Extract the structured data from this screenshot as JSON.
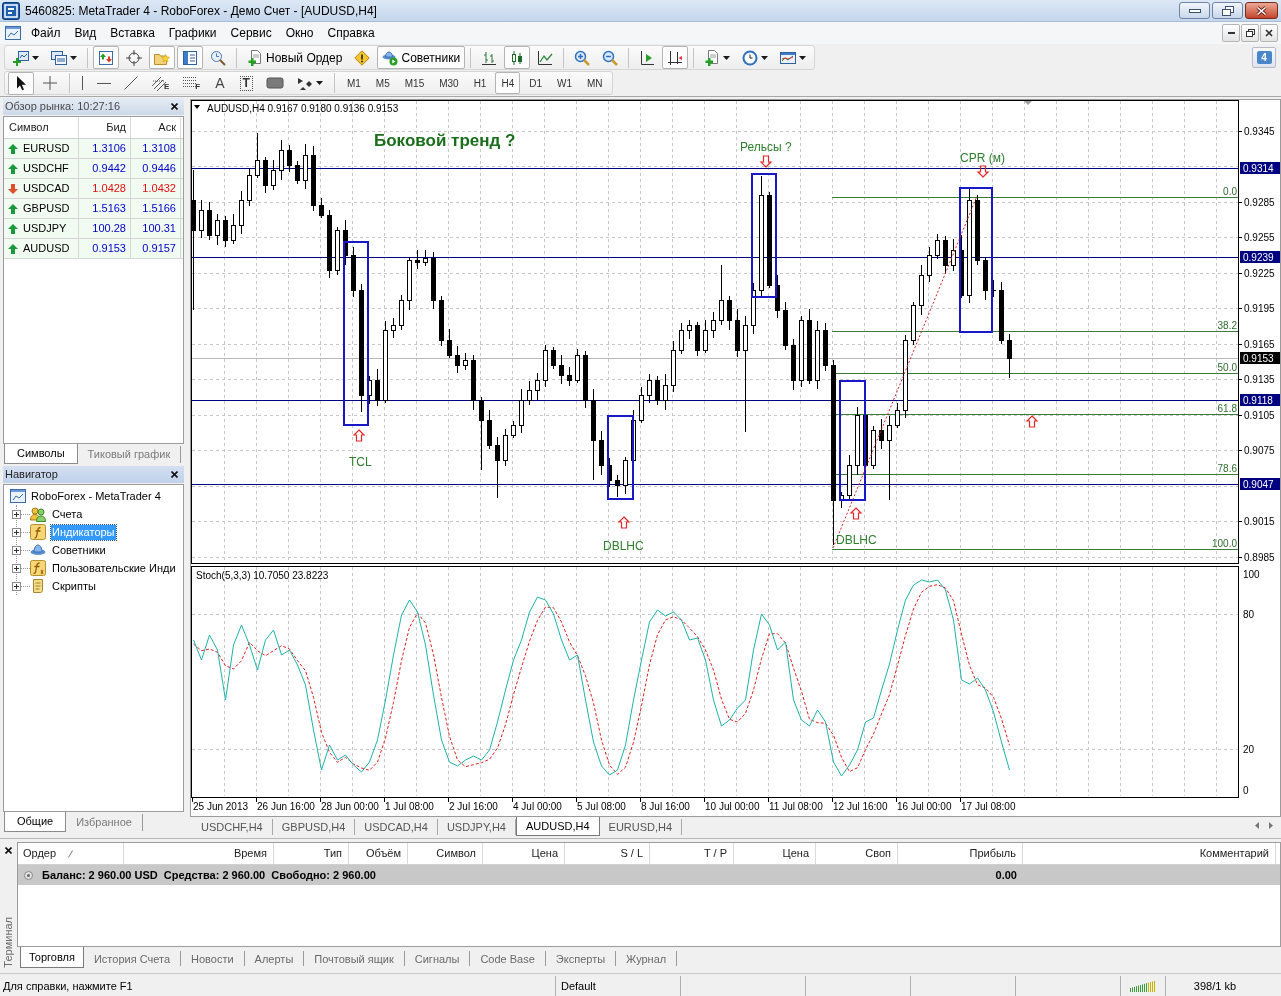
{
  "window": {
    "title": "5460825: MetaTrader 4 - RoboForex - Демо Счет - [AUDUSD,H4]"
  },
  "menu": [
    "Файл",
    "Вид",
    "Вставка",
    "Графики",
    "Сервис",
    "Окно",
    "Справка"
  ],
  "toolbar": [
    [
      {
        "kind": "new-chart",
        "dropdown": true,
        "pressed": false
      },
      {
        "kind": "profiles",
        "dropdown": true,
        "pressed": false
      }
    ],
    [
      {
        "kind": "market-watch",
        "pressed": true
      },
      {
        "kind": "data-window",
        "pressed": false
      },
      {
        "kind": "navigator",
        "pressed": true
      },
      {
        "kind": "terminal",
        "pressed": true
      },
      {
        "kind": "tester",
        "pressed": false
      }
    ],
    [
      {
        "kind": "new-order",
        "label": "Новый Ордер",
        "pressed": false
      },
      {
        "kind": "autotrading-alert",
        "pressed": false
      },
      {
        "kind": "experts",
        "label": "Советники",
        "pressed": true
      }
    ],
    [
      {
        "kind": "bar-chart",
        "pressed": false
      },
      {
        "kind": "candlesticks",
        "pressed": true
      },
      {
        "kind": "line-chart",
        "pressed": false
      }
    ],
    [
      {
        "kind": "zoom-in",
        "pressed": false
      },
      {
        "kind": "zoom-out",
        "pressed": false
      }
    ],
    [
      {
        "kind": "auto-scroll",
        "pressed": false
      },
      {
        "kind": "chart-shift",
        "pressed": true
      }
    ],
    [
      {
        "kind": "indicators",
        "dropdown": true,
        "pressed": false
      },
      {
        "kind": "periods",
        "dropdown": true,
        "pressed": false
      },
      {
        "kind": "templates",
        "dropdown": true,
        "pressed": false
      }
    ]
  ],
  "drawing_tools": [
    [
      {
        "kind": "cursor",
        "pressed": true
      },
      {
        "kind": "crosshair",
        "pressed": false
      }
    ],
    [
      {
        "kind": "vertical-line",
        "pressed": false
      },
      {
        "kind": "horizontal-line",
        "pressed": false
      },
      {
        "kind": "trendline",
        "pressed": false
      },
      {
        "kind": "fibo-channel",
        "glyph": "E",
        "pressed": false
      },
      {
        "kind": "fibo-levels",
        "glyph": "F",
        "pressed": false
      },
      {
        "kind": "text",
        "glyph": "A",
        "pressed": false
      },
      {
        "kind": "text-label",
        "glyph": "T",
        "pressed": false
      },
      {
        "kind": "rectangle",
        "pressed": false
      },
      {
        "kind": "arrows",
        "dropdown": true,
        "pressed": false
      }
    ]
  ],
  "periods": [
    {
      "label": "M1",
      "selected": false
    },
    {
      "label": "M5",
      "selected": false
    },
    {
      "label": "M15",
      "selected": false
    },
    {
      "label": "M30",
      "selected": false
    },
    {
      "label": "H1",
      "selected": false
    },
    {
      "label": "H4",
      "selected": true
    },
    {
      "label": "D1",
      "selected": false
    },
    {
      "label": "W1",
      "selected": false
    },
    {
      "label": "MN",
      "selected": false
    }
  ],
  "notifications": {
    "count": "4"
  },
  "market_watch": {
    "title": "Обзор рынка: 10:27:16",
    "columns": [
      "Символ",
      "Бид",
      "Аск"
    ],
    "rows": [
      {
        "symbol": "EURUSD",
        "bid": "1.3106",
        "ask": "1.3108",
        "rising": true
      },
      {
        "symbol": "USDCHF",
        "bid": "0.9442",
        "ask": "0.9446",
        "rising": true
      },
      {
        "symbol": "USDCAD",
        "bid": "1.0428",
        "ask": "1.0432",
        "rising": false
      },
      {
        "symbol": "GBPUSD",
        "bid": "1.5163",
        "ask": "1.5166",
        "rising": true
      },
      {
        "symbol": "USDJPY",
        "bid": "100.28",
        "ask": "100.31",
        "rising": true
      },
      {
        "symbol": "AUDUSD",
        "bid": "0.9153",
        "ask": "0.9157",
        "rising": true
      }
    ],
    "tabs": [
      {
        "label": "Символы",
        "selected": true
      },
      {
        "label": "Тиковый график",
        "selected": false
      }
    ]
  },
  "navigator": {
    "title": "Навигатор",
    "root": "RoboForex - MetaTrader 4",
    "items": [
      {
        "kind": "accounts",
        "label": "Счета",
        "expanded": false,
        "selected": false
      },
      {
        "kind": "indicators",
        "label": "Индикаторы",
        "expanded": false,
        "selected": true
      },
      {
        "kind": "experts",
        "label": "Советники",
        "expanded": false,
        "selected": false
      },
      {
        "kind": "custom-indicators",
        "label": "Пользовательские Инди",
        "expanded": false,
        "selected": false
      },
      {
        "kind": "scripts",
        "label": "Скрипты",
        "expanded": false,
        "selected": false
      }
    ],
    "tabs": [
      {
        "label": "Общие",
        "selected": true
      },
      {
        "label": "Избранное",
        "selected": false
      }
    ]
  },
  "chart": {
    "header": "AUDUSD,H4 0.9167 0.9180 0.9136 0.9153",
    "price_ticks": [
      "0.9345",
      "0.9285",
      "0.9255",
      "0.9225",
      "0.9195",
      "0.9165",
      "0.9135",
      "0.9105",
      "0.9075",
      "0.9015",
      "0.8985"
    ],
    "levels": [
      {
        "kind": "horizontal",
        "label": "0.9314"
      },
      {
        "kind": "horizontal",
        "label": "0.9239"
      },
      {
        "kind": "bid",
        "label": "0.9153"
      },
      {
        "kind": "horizontal",
        "label": "0.9118"
      },
      {
        "kind": "horizontal",
        "label": "0.9047"
      }
    ],
    "fibo_levels": [
      "0.0",
      "38.2",
      "50.0",
      "61.8",
      "78.6",
      "100.0"
    ],
    "annotations": [
      {
        "kind": "title",
        "text": "Боковой тренд ?"
      },
      {
        "kind": "label",
        "text": "Рельсы ?"
      },
      {
        "kind": "label",
        "text": "CPR (м)"
      },
      {
        "kind": "label",
        "text": "TCL"
      },
      {
        "kind": "label",
        "text": "DBLHC"
      },
      {
        "kind": "label",
        "text": "DBLHC"
      }
    ],
    "indicator": {
      "header": "Stoch(5,3,3) 10.7050 23.8223",
      "ticks": [
        "100",
        "80",
        "20",
        "0"
      ]
    },
    "time_ticks": [
      "25 Jun 2013",
      "26 Jun 16:00",
      "28 Jun 00:00",
      "1 Jul 08:00",
      "2 Jul 16:00",
      "4 Jul 00:00",
      "5 Jul 08:00",
      "8 Jul 16:00",
      "10 Jul 00:00",
      "11 Jul 08:00",
      "12 Jul 16:00",
      "16 Jul 00:00",
      "17 Jul 08:00"
    ],
    "tabs": [
      {
        "label": "USDCHF,H4",
        "selected": false
      },
      {
        "label": "GBPUSD,H4",
        "selected": false
      },
      {
        "label": "USDCAD,H4",
        "selected": false
      },
      {
        "label": "USDJPY,H4",
        "selected": false
      },
      {
        "label": "AUDUSD,H4",
        "selected": true
      },
      {
        "label": "EURUSD,H4",
        "selected": false
      }
    ]
  },
  "terminal": {
    "title": "Терминал",
    "columns": [
      {
        "label": "Ордер",
        "sorted": true
      },
      {
        "label": "Время",
        "sorted": false
      },
      {
        "label": "Тип",
        "sorted": false
      },
      {
        "label": "Объём",
        "sorted": false
      },
      {
        "label": "Символ",
        "sorted": false
      },
      {
        "label": "Цена",
        "sorted": false
      },
      {
        "label": "S / L",
        "sorted": false
      },
      {
        "label": "T / P",
        "sorted": false
      },
      {
        "label": "Цена",
        "sorted": false
      },
      {
        "label": "Своп",
        "sorted": false
      },
      {
        "label": "Прибыль",
        "sorted": false
      },
      {
        "label": "Комментарий",
        "sorted": false
      }
    ],
    "balance": {
      "summary": "Баланс: 2 960.00 USD  Средства: 2 960.00  Свободно: 2 960.00",
      "profit": "0.00"
    },
    "tabs": [
      {
        "label": "Торговля",
        "selected": true
      },
      {
        "label": "История Счета",
        "selected": false
      },
      {
        "label": "Новости",
        "selected": false
      },
      {
        "label": "Алерты",
        "selected": false
      },
      {
        "label": "Почтовый ящик",
        "selected": false
      },
      {
        "label": "Сигналы",
        "selected": false
      },
      {
        "label": "Code Base",
        "selected": false
      },
      {
        "label": "Эксперты",
        "selected": false
      },
      {
        "label": "Журнал",
        "selected": false
      }
    ]
  },
  "status_bar": {
    "help": "Для справки, нажмите F1",
    "profile": "Default",
    "traffic": "398/1 kb"
  }
}
